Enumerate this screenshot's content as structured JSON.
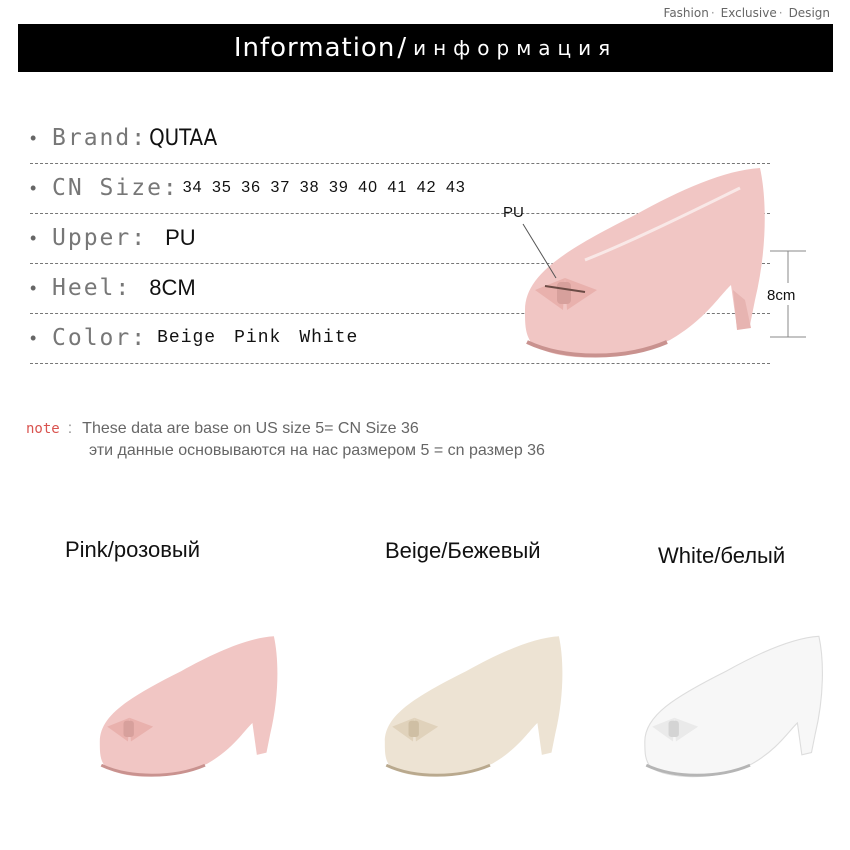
{
  "header": {
    "tagline": [
      "Fashion",
      "Exclusive",
      "Design"
    ],
    "title": "Information",
    "title_ru": "информация"
  },
  "specs": {
    "brand": {
      "label": "Brand:",
      "value": "QUTAA"
    },
    "size": {
      "label": "CN Size:",
      "value": "34 35 36 37 38 39 40 41 42 43"
    },
    "upper": {
      "label": "Upper:",
      "value": "PU"
    },
    "heel": {
      "label": "Heel:",
      "value": "8CM"
    },
    "color": {
      "label": "Color:",
      "values": [
        "Beige",
        "Pink",
        "White"
      ]
    }
  },
  "callouts": {
    "upper": "PU",
    "heel": "8cm"
  },
  "note": {
    "key": "note",
    "line1": "These data are base on US size 5= CN Size 36",
    "line2": "эти данные основываются на нас размером 5 = cn размер 36"
  },
  "variants": [
    {
      "name": "Pink/розовый",
      "color": "#f1c6c4"
    },
    {
      "name": "Beige/Бежевый",
      "color": "#ede3d3"
    },
    {
      "name": "White/белый",
      "color": "#f7f7f7"
    }
  ],
  "colors": {
    "banner_bg": "#000000",
    "note_key": "#d9534f",
    "dash": "#777777"
  }
}
